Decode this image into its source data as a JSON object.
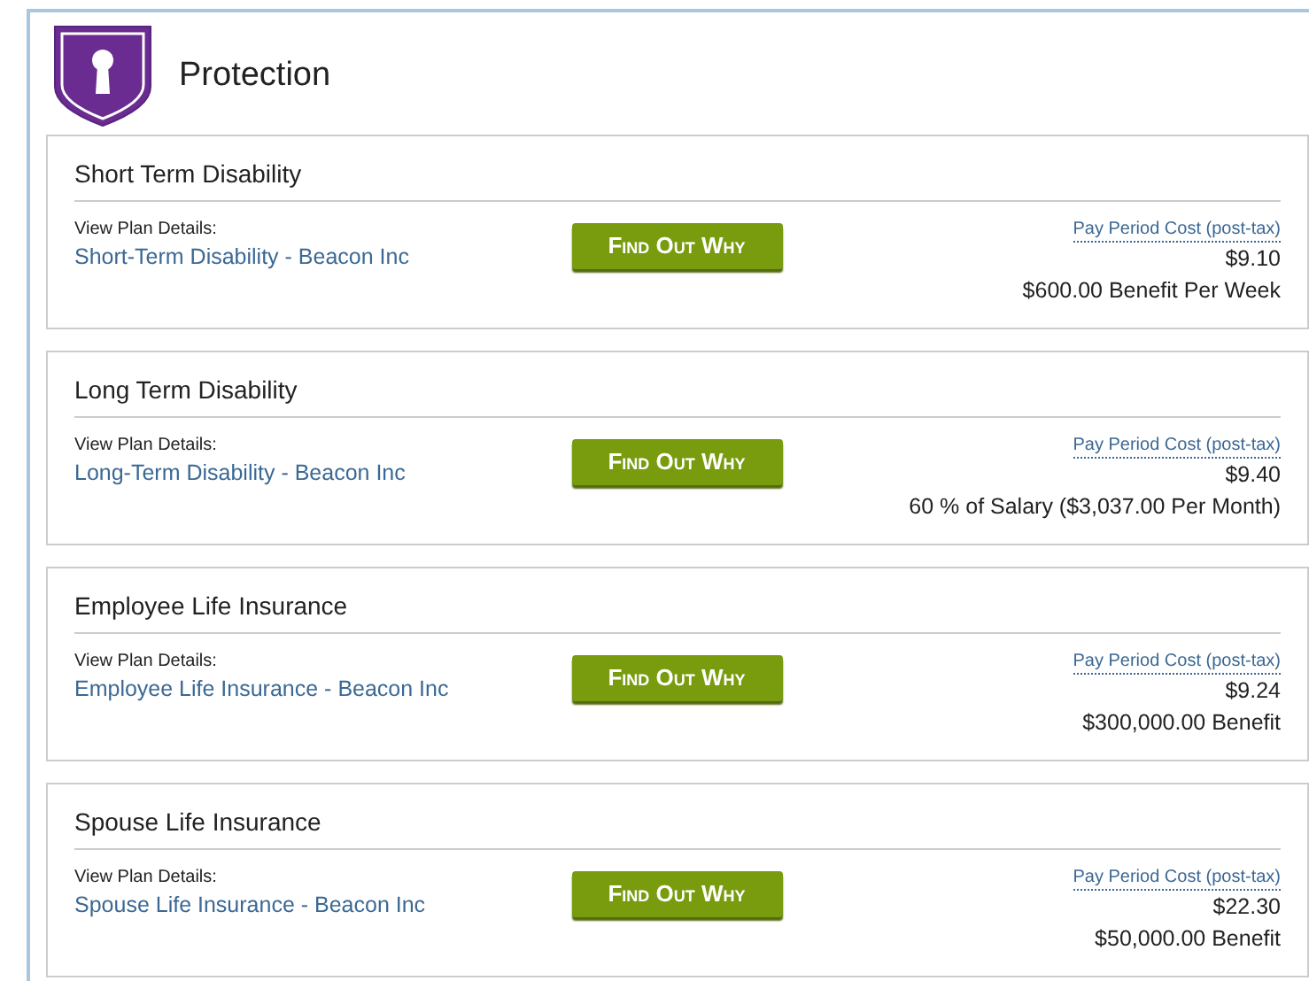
{
  "header": {
    "title": "Protection"
  },
  "plans": [
    {
      "title": "Short Term Disability",
      "details_label": "View Plan Details:",
      "plan_link": "Short-Term Disability - Beacon Inc",
      "button": "Find Out Why",
      "cost_label": "Pay Period Cost (post-tax)",
      "cost": "$9.10",
      "benefit": "$600.00 Benefit Per Week"
    },
    {
      "title": "Long Term Disability",
      "details_label": "View Plan Details:",
      "plan_link": "Long-Term Disability - Beacon Inc",
      "button": "Find Out Why",
      "cost_label": "Pay Period Cost (post-tax)",
      "cost": "$9.40",
      "benefit": "60 % of Salary ($3,037.00 Per Month)"
    },
    {
      "title": "Employee Life Insurance",
      "details_label": "View Plan Details:",
      "plan_link": "Employee Life Insurance - Beacon Inc",
      "button": "Find Out Why",
      "cost_label": "Pay Period Cost (post-tax)",
      "cost": "$9.24",
      "benefit": "$300,000.00 Benefit"
    },
    {
      "title": "Spouse Life Insurance",
      "details_label": "View Plan Details:",
      "plan_link": "Spouse Life Insurance - Beacon Inc",
      "button": "Find Out Why",
      "cost_label": "Pay Period Cost (post-tax)",
      "cost": "$22.30",
      "benefit": "$50,000.00 Benefit"
    }
  ]
}
